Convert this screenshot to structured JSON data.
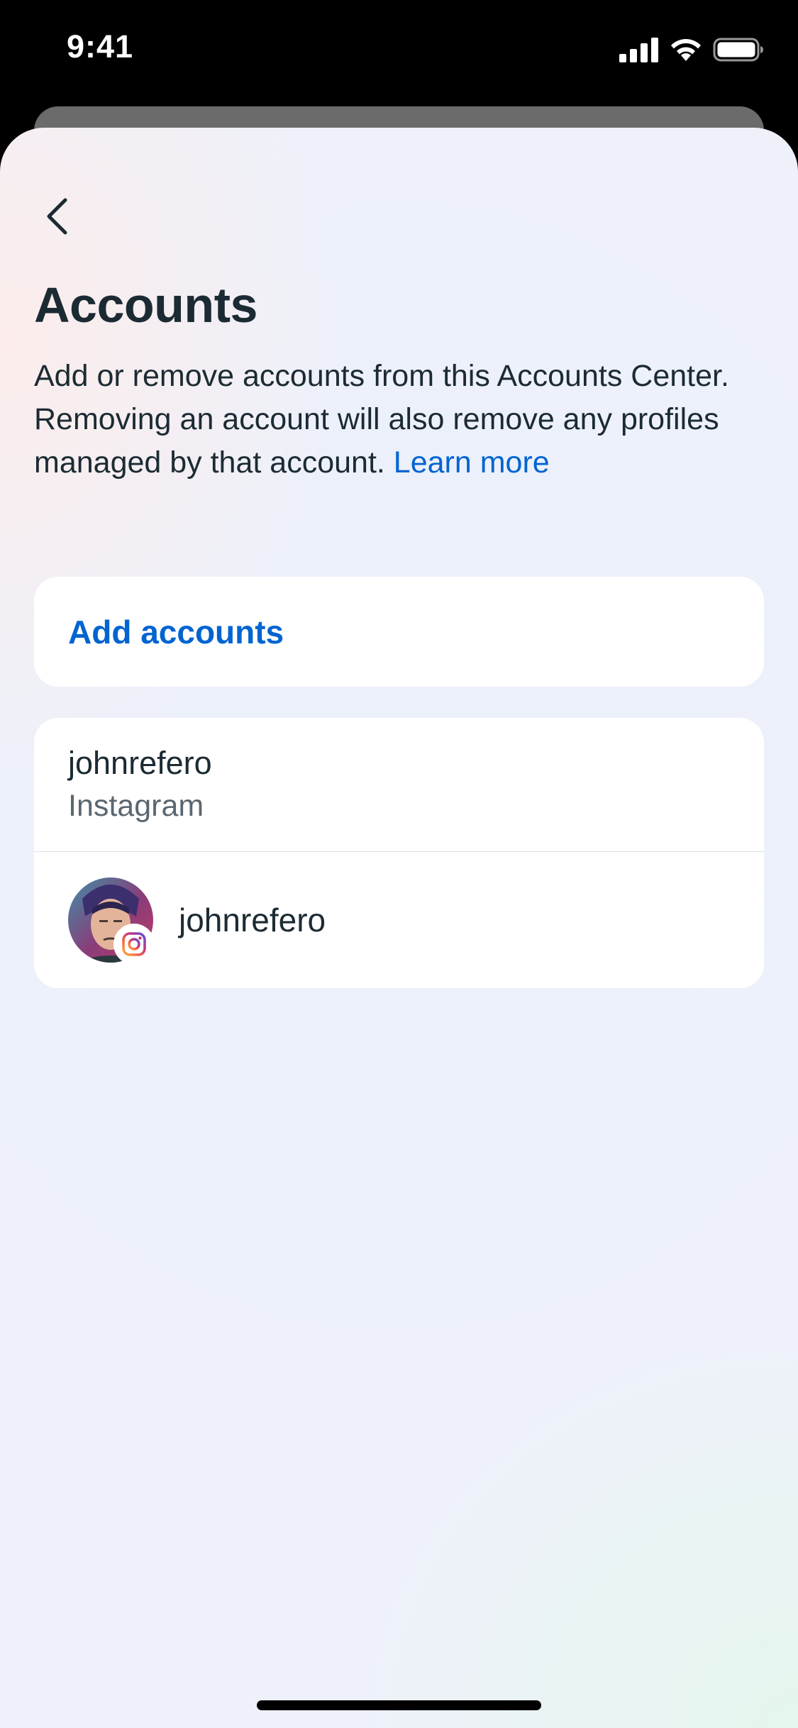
{
  "status_bar": {
    "time": "9:41"
  },
  "header": {
    "title": "Accounts"
  },
  "description": {
    "text": "Add or remove accounts from this Accounts Center. Removing an account will also remove any profiles managed by that account. ",
    "link": "Learn more"
  },
  "add_accounts": {
    "label": "Add accounts"
  },
  "account": {
    "username": "johnrefero",
    "platform": "Instagram",
    "profile": {
      "name": "johnrefero",
      "badge_icon": "instagram-icon"
    }
  },
  "colors": {
    "accent": "#0064d1",
    "text": "#1c2b33",
    "secondary_text": "#5b6770"
  }
}
